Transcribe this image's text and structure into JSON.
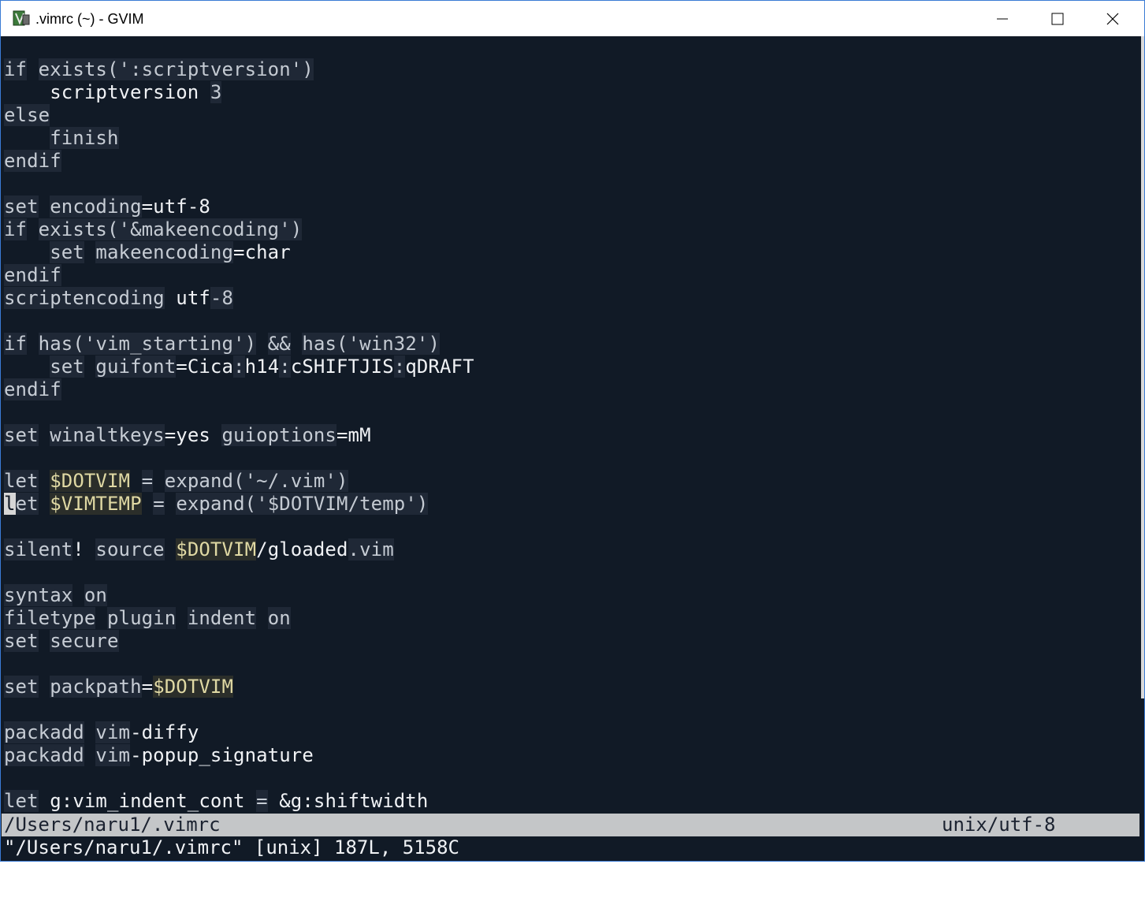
{
  "window": {
    "title": ".vimrc (~) - GVIM",
    "controls": {
      "minimize_icon": "minimize-icon",
      "maximize_icon": "maximize-icon",
      "close_icon": "close-icon"
    }
  },
  "colors": {
    "background": "#111a26",
    "titlebar": "#ffffff",
    "statusline_bg": "#c4c6c8",
    "string_bg": "#1f2836",
    "variable_fg": "#e0d9a4"
  },
  "editor": {
    "lines": [
      [
        [
          "kw",
          "if"
        ],
        [
          "pl",
          " "
        ],
        [
          "fn",
          "exists"
        ],
        [
          "op",
          "("
        ],
        [
          "str",
          "':scriptversion'"
        ],
        [
          "op",
          ")"
        ]
      ],
      [
        [
          "pl",
          "    "
        ],
        [
          "id",
          "scriptversion"
        ],
        [
          "pl",
          " "
        ],
        [
          "num",
          "3"
        ]
      ],
      [
        [
          "kw",
          "else"
        ]
      ],
      [
        [
          "pl",
          "    "
        ],
        [
          "kw",
          "finish"
        ]
      ],
      [
        [
          "kw",
          "endif"
        ]
      ],
      [],
      [
        [
          "kw",
          "set"
        ],
        [
          "pl",
          " "
        ],
        [
          "op",
          "encoding"
        ],
        [
          "id",
          "=utf-8"
        ]
      ],
      [
        [
          "kw",
          "if"
        ],
        [
          "pl",
          " "
        ],
        [
          "fn",
          "exists"
        ],
        [
          "op",
          "("
        ],
        [
          "str",
          "'&makeencoding'"
        ],
        [
          "op",
          ")"
        ]
      ],
      [
        [
          "pl",
          "    "
        ],
        [
          "kw",
          "set"
        ],
        [
          "pl",
          " "
        ],
        [
          "op",
          "makeencoding"
        ],
        [
          "id",
          "=char"
        ]
      ],
      [
        [
          "kw",
          "endif"
        ]
      ],
      [
        [
          "kw",
          "scriptencoding"
        ],
        [
          "pl",
          " "
        ],
        [
          "id",
          "utf"
        ],
        [
          "op",
          "-"
        ],
        [
          "num",
          "8"
        ]
      ],
      [],
      [
        [
          "kw",
          "if"
        ],
        [
          "pl",
          " "
        ],
        [
          "fn",
          "has"
        ],
        [
          "op",
          "("
        ],
        [
          "str",
          "'vim_starting'"
        ],
        [
          "op",
          ")"
        ],
        [
          "pl",
          " "
        ],
        [
          "op",
          "&&"
        ],
        [
          "pl",
          " "
        ],
        [
          "fn",
          "has"
        ],
        [
          "op",
          "("
        ],
        [
          "str",
          "'win32'"
        ],
        [
          "op",
          ")"
        ]
      ],
      [
        [
          "pl",
          "    "
        ],
        [
          "kw",
          "set"
        ],
        [
          "pl",
          " "
        ],
        [
          "op",
          "guifont"
        ],
        [
          "id",
          "=Cica"
        ],
        [
          "op",
          ":"
        ],
        [
          "id",
          "h14"
        ],
        [
          "op",
          ":"
        ],
        [
          "id",
          "cSHIFTJIS"
        ],
        [
          "op",
          ":"
        ],
        [
          "id",
          "qDRAFT"
        ]
      ],
      [
        [
          "kw",
          "endif"
        ]
      ],
      [],
      [
        [
          "kw",
          "set"
        ],
        [
          "pl",
          " "
        ],
        [
          "op",
          "winaltkeys"
        ],
        [
          "id",
          "=yes"
        ],
        [
          "pl",
          " "
        ],
        [
          "op",
          "guioptions"
        ],
        [
          "id",
          "=mM"
        ]
      ],
      [],
      [
        [
          "kw",
          "let"
        ],
        [
          "pl",
          " "
        ],
        [
          "var",
          "$DOTVIM"
        ],
        [
          "pl",
          " "
        ],
        [
          "op",
          "="
        ],
        [
          "pl",
          " "
        ],
        [
          "fn",
          "expand"
        ],
        [
          "op",
          "("
        ],
        [
          "str",
          "'~/.vim'"
        ],
        [
          "op",
          ")"
        ]
      ],
      [
        [
          "cur",
          "l"
        ],
        [
          "kw",
          "et"
        ],
        [
          "pl",
          " "
        ],
        [
          "var",
          "$VIMTEMP"
        ],
        [
          "pl",
          " "
        ],
        [
          "op",
          "="
        ],
        [
          "pl",
          " "
        ],
        [
          "fn",
          "expand"
        ],
        [
          "op",
          "("
        ],
        [
          "str",
          "'$DOTVIM/temp'"
        ],
        [
          "op",
          ")"
        ]
      ],
      [],
      [
        [
          "kw",
          "silent"
        ],
        [
          "id",
          "!"
        ],
        [
          "pl",
          " "
        ],
        [
          "kw",
          "source"
        ],
        [
          "pl",
          " "
        ],
        [
          "var",
          "$DOTVIM"
        ],
        [
          "id",
          "/gloaded"
        ],
        [
          "op",
          ".vim"
        ]
      ],
      [],
      [
        [
          "kw",
          "syntax"
        ],
        [
          "pl",
          " "
        ],
        [
          "kw",
          "on"
        ]
      ],
      [
        [
          "kw",
          "filetype"
        ],
        [
          "pl",
          " "
        ],
        [
          "kw",
          "plugin"
        ],
        [
          "pl",
          " "
        ],
        [
          "kw",
          "indent"
        ],
        [
          "pl",
          " "
        ],
        [
          "kw",
          "on"
        ]
      ],
      [
        [
          "kw",
          "set"
        ],
        [
          "pl",
          " "
        ],
        [
          "op",
          "secure"
        ]
      ],
      [],
      [
        [
          "kw",
          "set"
        ],
        [
          "pl",
          " "
        ],
        [
          "op",
          "packpath"
        ],
        [
          "id",
          "="
        ],
        [
          "var",
          "$DOTVIM"
        ]
      ],
      [],
      [
        [
          "kw",
          "packadd"
        ],
        [
          "pl",
          " "
        ],
        [
          "op",
          "vim"
        ],
        [
          "id",
          "-diffy"
        ]
      ],
      [
        [
          "kw",
          "packadd"
        ],
        [
          "pl",
          " "
        ],
        [
          "op",
          "vim"
        ],
        [
          "id",
          "-popup_signature"
        ]
      ],
      [],
      [
        [
          "kw",
          "let"
        ],
        [
          "pl",
          " "
        ],
        [
          "id",
          "g:vim_indent_cont"
        ],
        [
          "pl",
          " "
        ],
        [
          "op",
          "="
        ],
        [
          "pl",
          " "
        ],
        [
          "id",
          "&g:shiftwidth"
        ]
      ]
    ]
  },
  "statusline": {
    "file": "/Users/naru1/.vimrc",
    "encoding": "unix/utf-8"
  },
  "cmdline": {
    "message": "\"/Users/naru1/.vimrc\" [unix] 187L, 5158C"
  }
}
